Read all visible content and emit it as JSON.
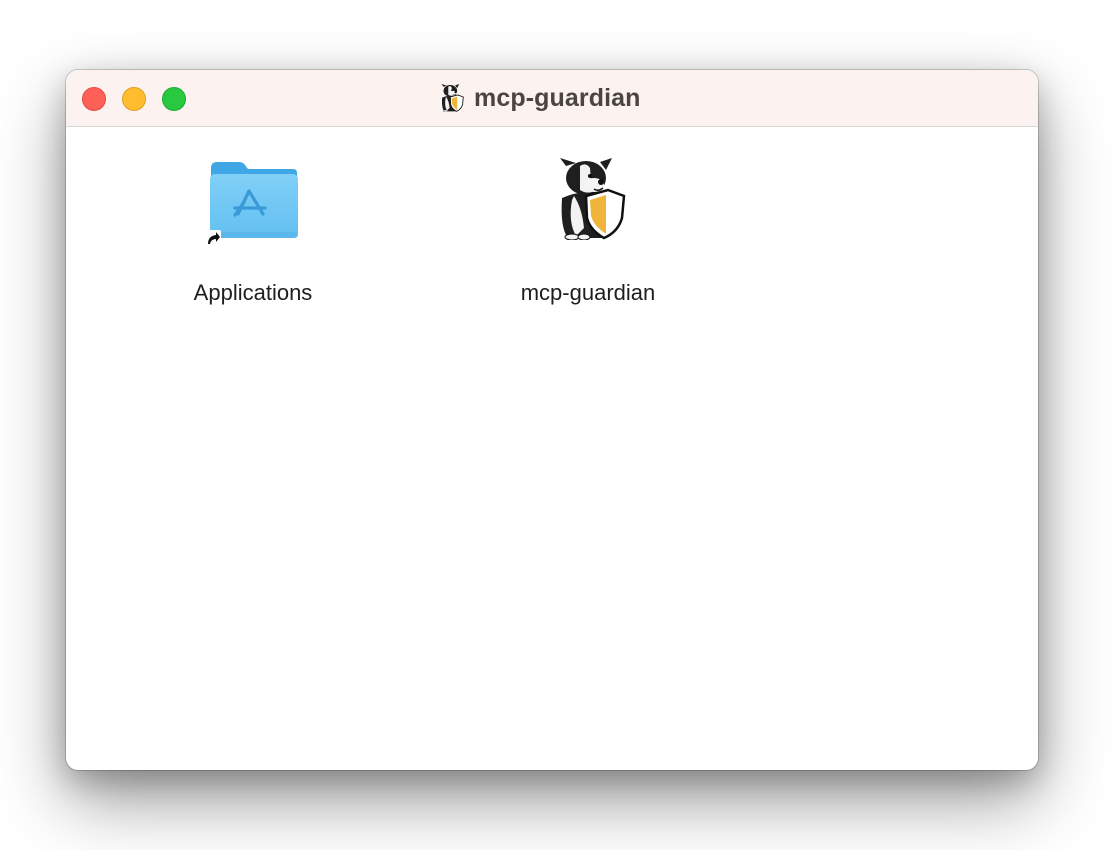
{
  "window": {
    "title": "mcp-guardian",
    "title_icon": "guardian-dog-icon",
    "controls": {
      "close": "close-button",
      "minimize": "minimize-button",
      "zoom": "zoom-button"
    }
  },
  "items": [
    {
      "label": "Applications",
      "icon": "applications-folder-alias-icon"
    },
    {
      "label": "mcp-guardian",
      "icon": "guardian-dog-shield-icon"
    }
  ],
  "colors": {
    "titlebar": "#fcf3f1",
    "close": "#fe5f57",
    "minimize": "#febc2e",
    "zoom": "#28c840",
    "folder": "#72c8f4",
    "shield": "#f2b53b"
  }
}
